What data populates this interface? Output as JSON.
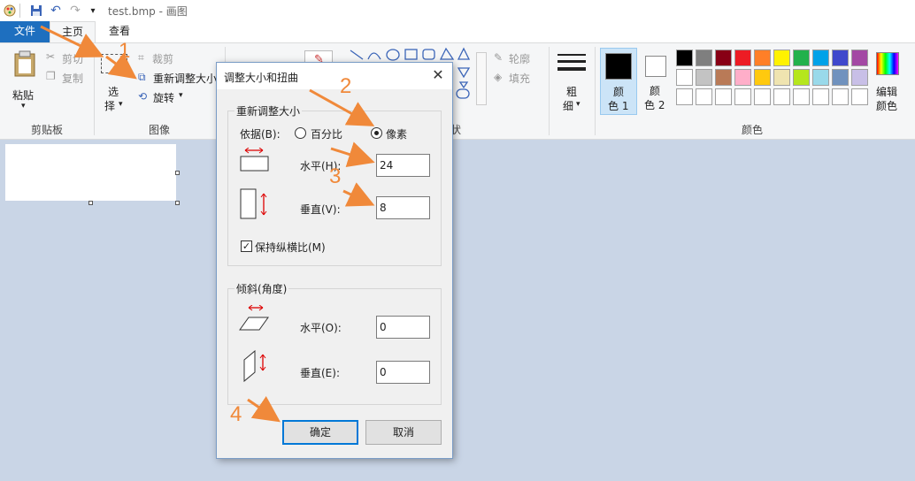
{
  "titlebar": {
    "title": "test.bmp - 画图"
  },
  "tabs": {
    "file": "文件",
    "home": "主页",
    "view": "查看"
  },
  "ribbon": {
    "clipboard": {
      "paste": "粘贴",
      "cut": "剪切",
      "copy": "复制",
      "group": "剪贴板"
    },
    "image": {
      "select_1": "选",
      "select_2": "择",
      "crop": "裁剪",
      "resize": "重新调整大小",
      "rotate": "旋转",
      "group": "图像"
    },
    "shapes": {
      "outline": "轮廓",
      "fill": "填充",
      "group_tail": "状"
    },
    "size": {
      "label_1": "粗",
      "label_2": "细"
    },
    "color1": {
      "label_1": "颜",
      "label_2": "色 1"
    },
    "color2": {
      "label_1": "颜",
      "label_2": "色 2"
    },
    "edit_colors": {
      "label_1": "编辑",
      "label_2": "颜色"
    },
    "colors_group": "颜色"
  },
  "palette": {
    "row1": [
      "#000000",
      "#7f7f7f",
      "#880015",
      "#ed1c24",
      "#ff7f27",
      "#fff200",
      "#22b14c",
      "#00a2e8",
      "#3f48cc",
      "#a349a4"
    ],
    "row2": [
      "#ffffff",
      "#c3c3c3",
      "#b97a57",
      "#ffaec9",
      "#ffc90e",
      "#efe4b0",
      "#b5e61d",
      "#99d9ea",
      "#7092be",
      "#c8bfe7"
    ]
  },
  "dialog": {
    "title": "调整大小和扭曲",
    "resize_legend": "重新调整大小",
    "by_label": "依据(B):",
    "percent": "百分比",
    "pixels": "像素",
    "horizontal_label": "水平(H):",
    "horizontal_value": "24",
    "vertical_label": "垂直(V):",
    "vertical_value": "8",
    "keep_ratio": "保持纵横比(M)",
    "skew_legend": "倾斜(角度)",
    "skew_h_label": "水平(O):",
    "skew_h_value": "0",
    "skew_v_label": "垂直(E):",
    "skew_v_value": "0",
    "ok": "确定",
    "cancel": "取消"
  },
  "annotations": {
    "n1": "1",
    "n2": "2",
    "n3": "3",
    "n4": "4"
  },
  "colors": {
    "accent": "#1e6fbf",
    "annotation": "#f0893a",
    "canvas_bg": "#c9d5e6"
  }
}
